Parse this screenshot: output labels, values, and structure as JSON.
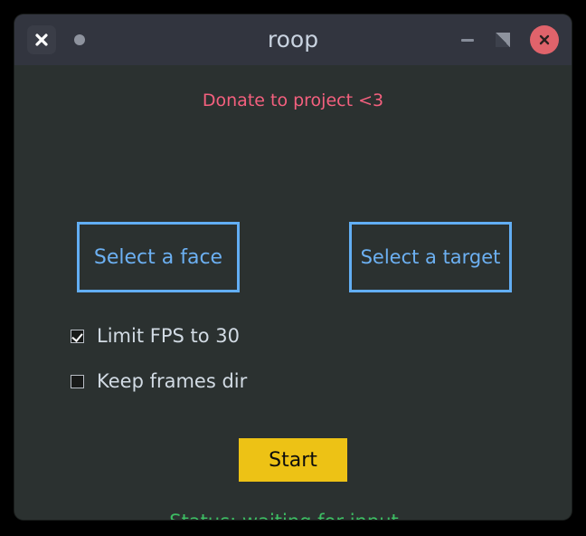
{
  "window": {
    "title": "roop",
    "titlebar": {
      "close_x_icon": "close-x-icon",
      "dot_icon": "dot-icon",
      "minimize_icon": "minimize-icon",
      "maximize_icon": "maximize-restore-icon",
      "close_icon": "close-circle-icon"
    }
  },
  "content": {
    "donate_label": "Donate to project <3",
    "select_face_label": "Select a face",
    "select_target_label": "Select a target",
    "checkboxes": [
      {
        "label": "Limit FPS to 30",
        "checked": true
      },
      {
        "label": "Keep frames dir",
        "checked": false
      }
    ],
    "start_label": "Start",
    "status_label": "Status: waiting for input..."
  },
  "colors": {
    "titlebar_bg": "#32353f",
    "window_bg": "#2b3130",
    "accent_blue": "#62aef4",
    "donate_pink": "#f4607e",
    "start_yellow": "#edc215",
    "status_green": "#3dbd63",
    "close_red": "#e0636b"
  }
}
